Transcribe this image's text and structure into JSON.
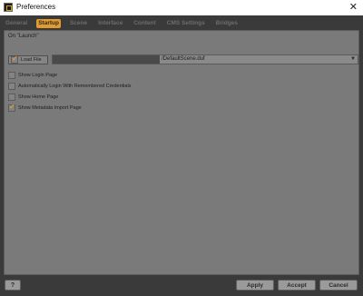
{
  "window": {
    "title": "Preferences",
    "close_glyph": "✕",
    "app_icon": "daz-studio-icon"
  },
  "tabs": [
    {
      "label": "General",
      "active": false
    },
    {
      "label": "Startup",
      "active": true
    },
    {
      "label": "Scene",
      "active": false
    },
    {
      "label": "Interface",
      "active": false
    },
    {
      "label": "Content",
      "active": false
    },
    {
      "label": "CMS Settings",
      "active": false
    },
    {
      "label": "Bridges",
      "active": false
    }
  ],
  "startup": {
    "section_label": "On \"Launch\"",
    "load_file": {
      "label": "Load File",
      "checked": true,
      "path": "/DefaultScene.duf"
    },
    "options": [
      {
        "label": "Show Login Page",
        "checked": false
      },
      {
        "label": "Automatically Login With Remembered Credentials",
        "checked": false
      },
      {
        "label": "Show Home Page",
        "checked": false
      },
      {
        "label": "Show Metadata Import Page",
        "checked": true
      }
    ]
  },
  "buttons": {
    "help": "?",
    "apply": "Apply",
    "accept": "Accept",
    "cancel": "Cancel"
  },
  "colors": {
    "accent": "#e39b2c",
    "panel": "#7a7a7a",
    "frame": "#3a3a3a"
  }
}
